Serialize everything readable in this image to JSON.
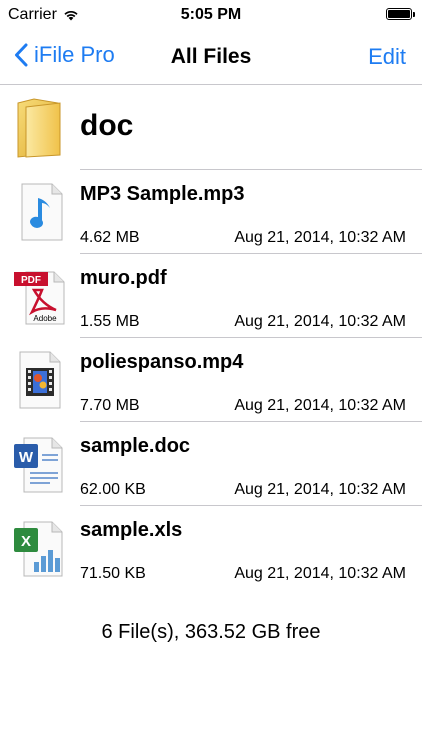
{
  "status_bar": {
    "carrier": "Carrier",
    "time": "5:05 PM",
    "battery_level": 1.0
  },
  "nav": {
    "back_label": "iFile Pro",
    "title": "All Files",
    "edit_label": "Edit"
  },
  "folder": {
    "name": "doc",
    "icon": "folder-icon"
  },
  "files": [
    {
      "name": "MP3 Sample.mp3",
      "size": "4.62 MB",
      "date": "Aug 21, 2014, 10:32 AM",
      "icon": "audio-file-icon"
    },
    {
      "name": "muro.pdf",
      "size": "1.55 MB",
      "date": "Aug 21, 2014, 10:32 AM",
      "icon": "pdf-file-icon"
    },
    {
      "name": "poliespanso.mp4",
      "size": "7.70 MB",
      "date": "Aug 21, 2014, 10:32 AM",
      "icon": "video-file-icon"
    },
    {
      "name": "sample.doc",
      "size": "62.00 KB",
      "date": "Aug 21, 2014, 10:32 AM",
      "icon": "word-file-icon"
    },
    {
      "name": "sample.xls",
      "size": "71.50 KB",
      "date": "Aug 21, 2014, 10:32 AM",
      "icon": "excel-file-icon"
    }
  ],
  "summary": "6 File(s), 363.52 GB free",
  "colors": {
    "accent": "#1e7cf2",
    "separator": "#c8c7cc",
    "folder": "#f2c94c"
  }
}
